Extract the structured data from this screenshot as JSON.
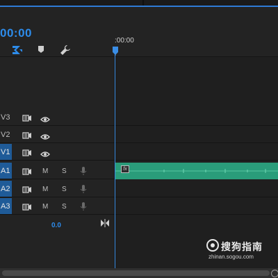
{
  "program_monitor": {
    "timecode": "00:00"
  },
  "ruler": {
    "label": ":00:00"
  },
  "toolbar": {
    "tools": [
      {
        "name": "snap-icon"
      },
      {
        "name": "add-marker-icon"
      },
      {
        "name": "wrench-icon"
      }
    ]
  },
  "tracks": {
    "video": [
      {
        "label": "V3"
      },
      {
        "label": "V2"
      },
      {
        "label": "V1"
      }
    ],
    "audio": [
      {
        "label": "A1",
        "mute": "M",
        "solo": "S"
      },
      {
        "label": "A2",
        "mute": "M",
        "solo": "S"
      },
      {
        "label": "A3",
        "mute": "M",
        "solo": "S"
      }
    ]
  },
  "master": {
    "volume": "0.0"
  },
  "clip": {
    "fx_badge": "fx"
  },
  "watermark": {
    "title": "搜狗指南",
    "url": "zhinan.sogou.com"
  },
  "colors": {
    "accent": "#2d8ceb",
    "active_track": "#1f5b98",
    "audio_clip": "#2a9c7a"
  }
}
